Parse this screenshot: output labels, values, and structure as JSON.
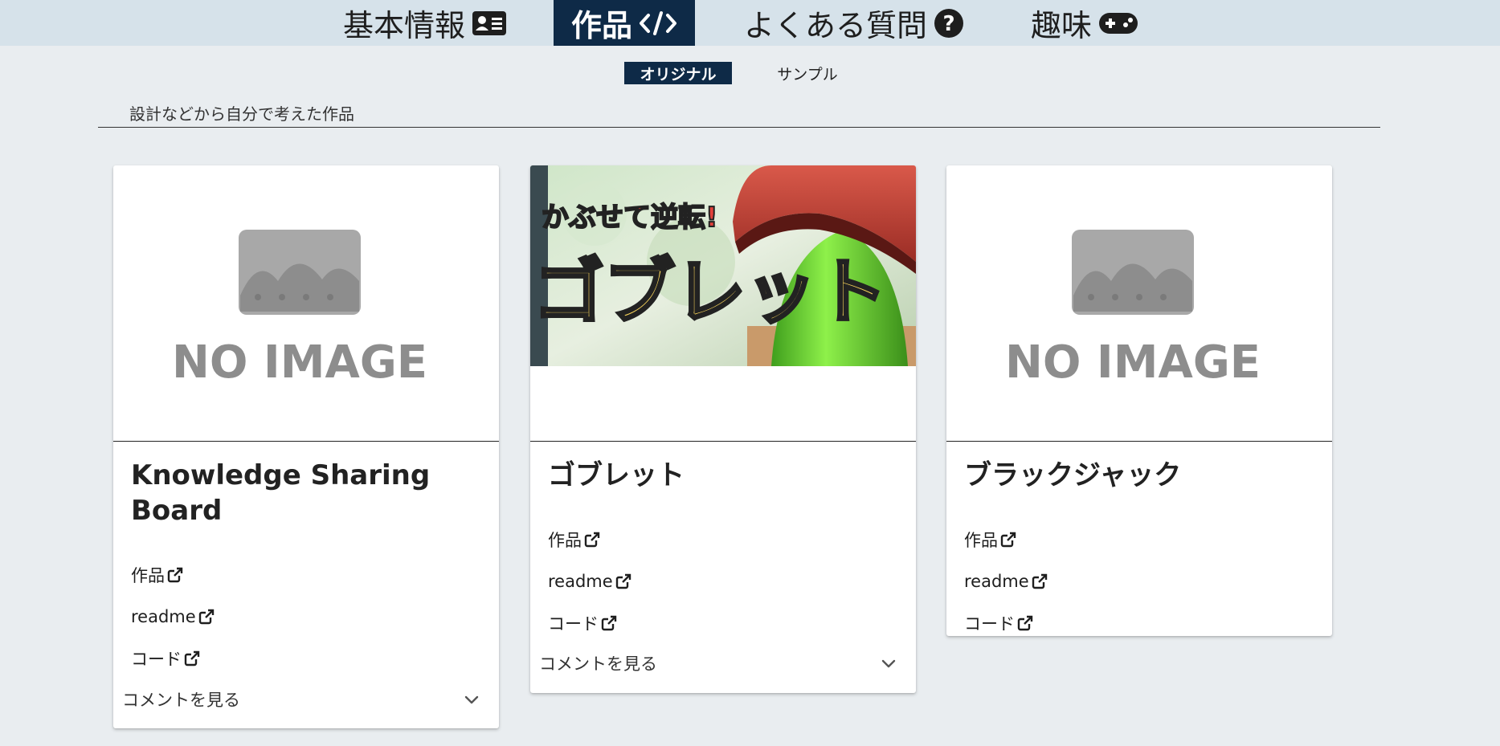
{
  "nav": {
    "tabs": [
      {
        "label": "基本情報",
        "icon": "id-card-icon",
        "active": false
      },
      {
        "label": "作品",
        "icon": "code-icon",
        "active": true
      },
      {
        "label": "よくある質問",
        "icon": "question-circle-icon",
        "active": false
      },
      {
        "label": "趣味",
        "icon": "gamepad-icon",
        "active": false
      }
    ]
  },
  "subtabs": [
    {
      "label": "オリジナル",
      "active": true
    },
    {
      "label": "サンプル",
      "active": false
    }
  ],
  "section": {
    "description": "設計などから自分で考えた作品"
  },
  "cards": [
    {
      "title": "Knowledge Sharing Board",
      "image": {
        "type": "no-image",
        "text": "NO IMAGE"
      },
      "links": [
        "作品",
        "readme",
        "コード"
      ],
      "comments_label": "コメントを見る"
    },
    {
      "title": "ゴブレット",
      "image": {
        "type": "thumbnail",
        "caption_top": "かぶせて逆転!",
        "caption_main": "ゴブレット"
      },
      "links": [
        "作品",
        "readme",
        "コード"
      ],
      "comments_label": "コメントを見る"
    },
    {
      "title": "ブラックジャック",
      "image": {
        "type": "no-image",
        "text": "NO IMAGE"
      },
      "links": [
        "作品",
        "readme",
        "コード"
      ]
    }
  ],
  "colors": {
    "nav_bg": "#d6e2ea",
    "page_bg": "#e9edf0",
    "active": "#0e2a47",
    "card_bg": "#ffffff"
  }
}
